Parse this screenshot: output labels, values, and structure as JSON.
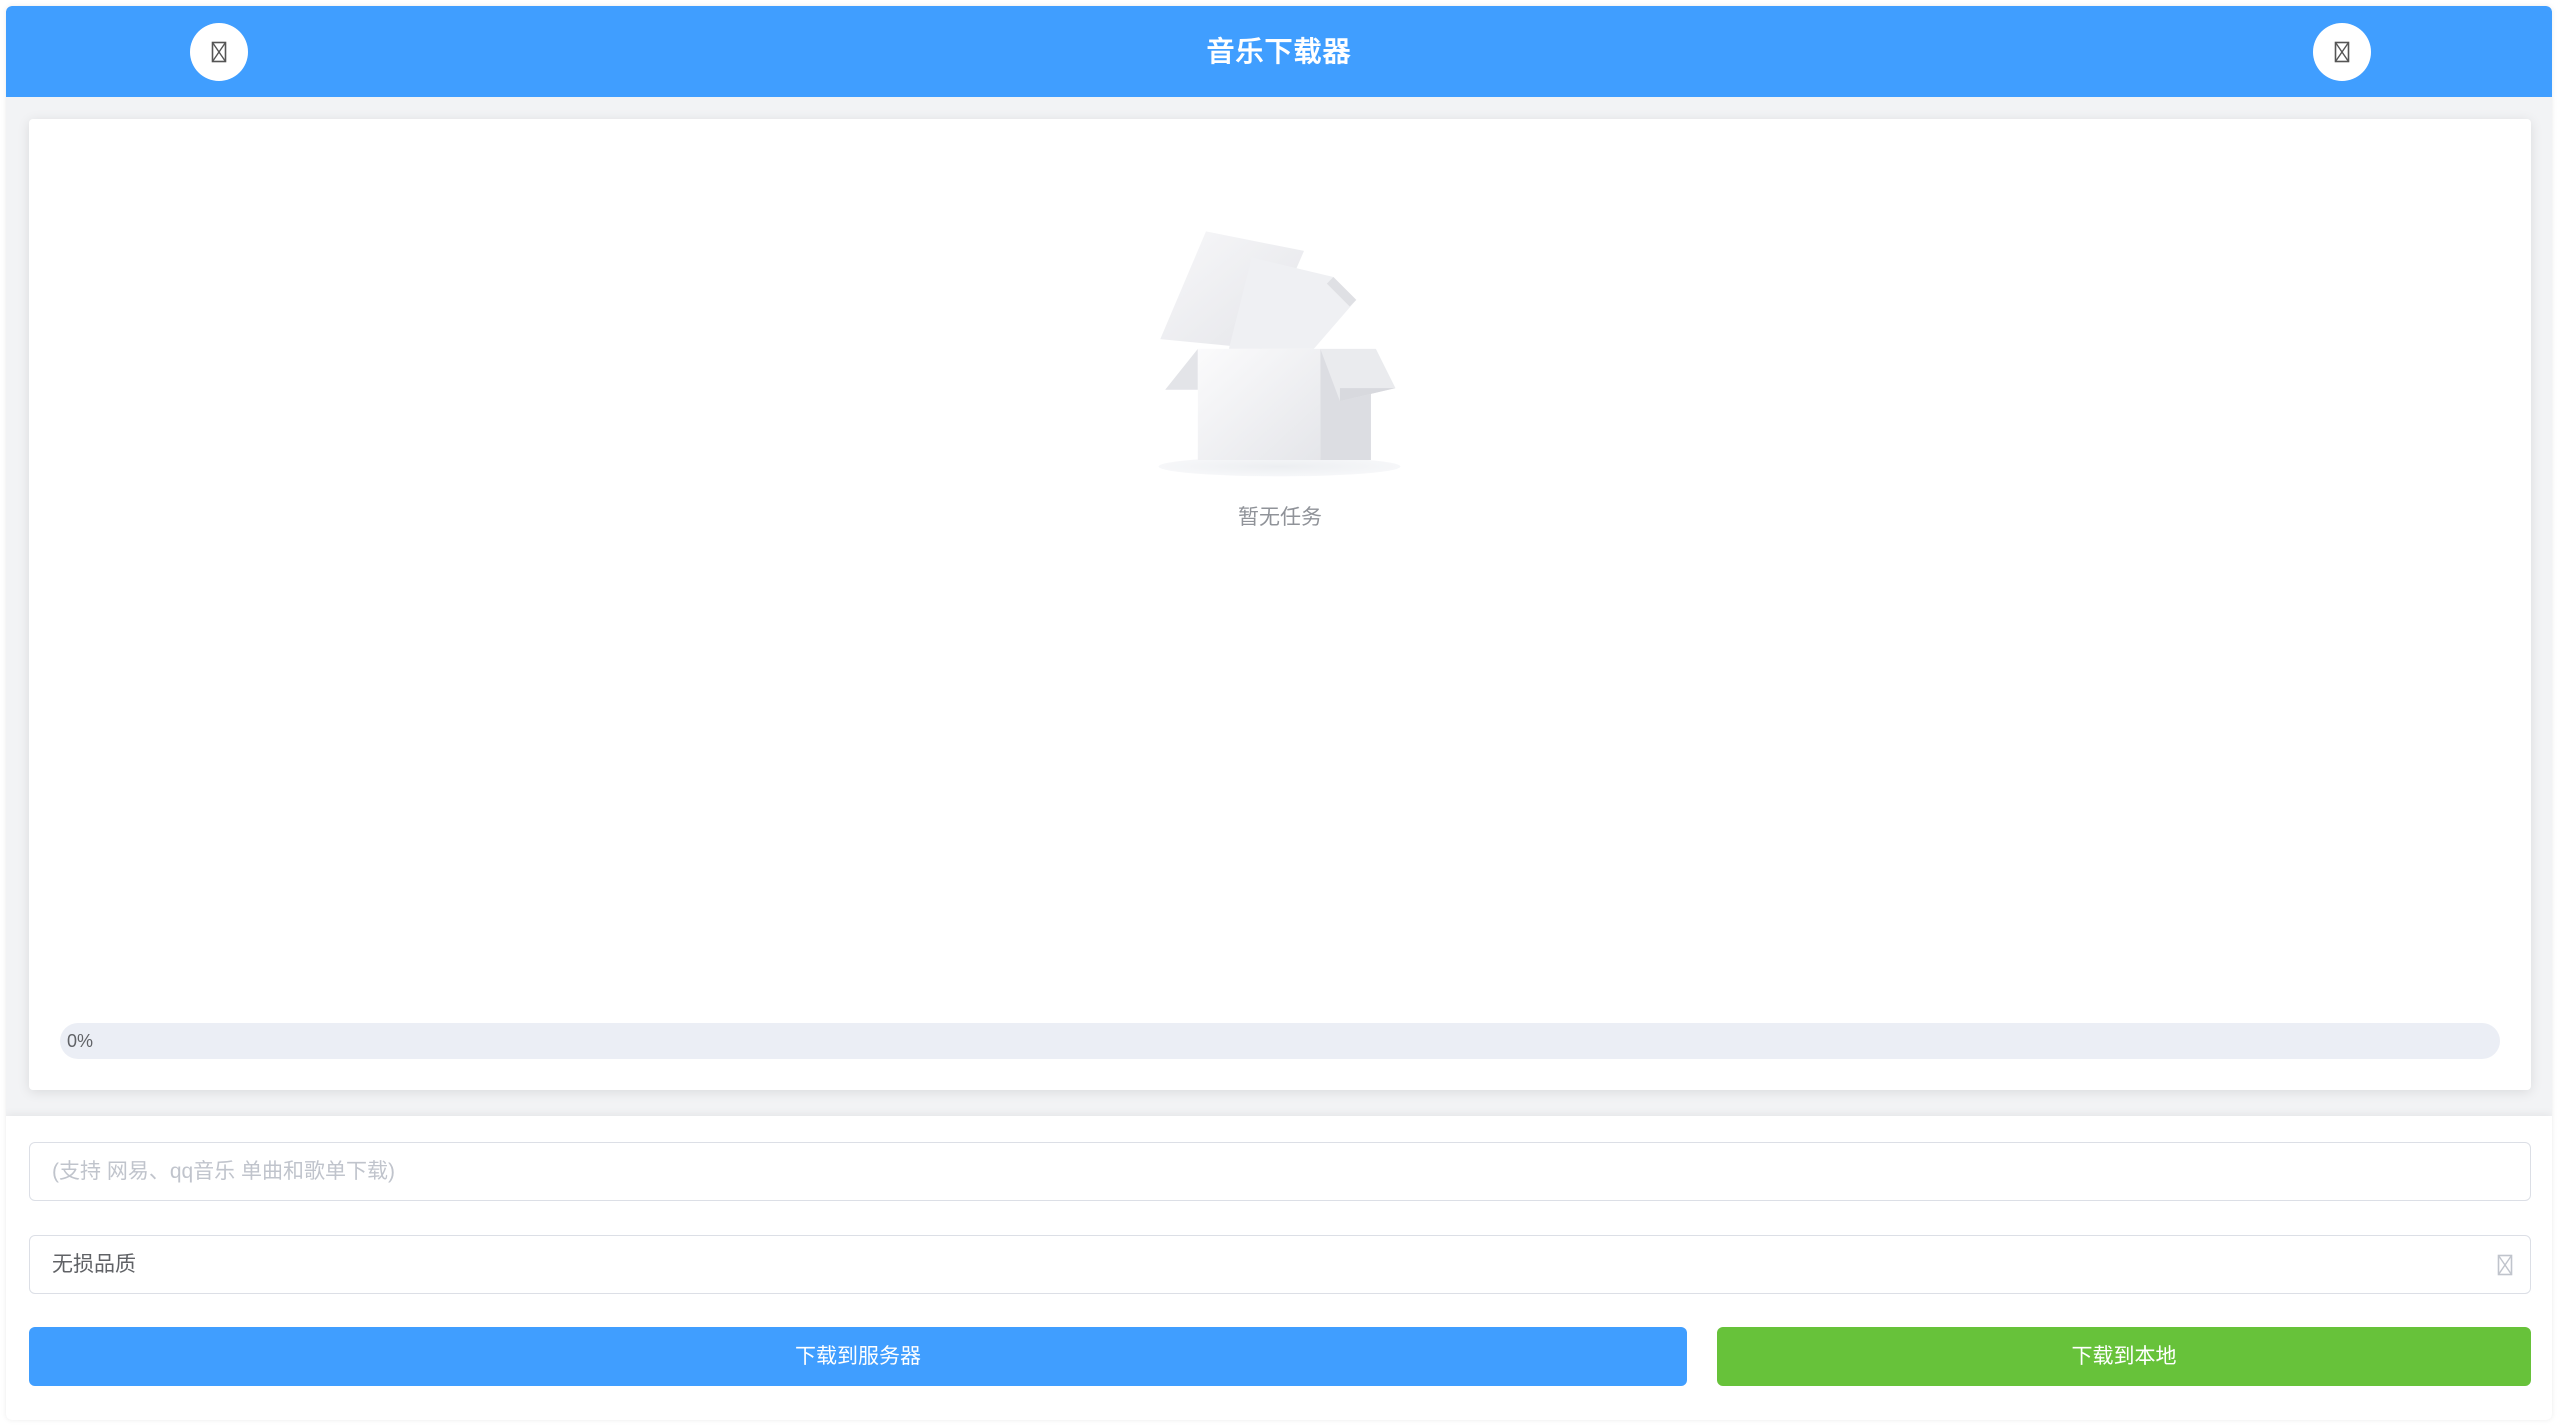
{
  "header": {
    "title": "音乐下载器",
    "left_button_icon": "missing-glyph-icon",
    "right_button_icon": "missing-glyph-icon",
    "background_color": "#409eff"
  },
  "task_panel": {
    "empty_image": "empty-box-illustration",
    "empty_text": "暂无任务",
    "progress": {
      "label": "0%",
      "value": 0
    }
  },
  "form": {
    "link_input": {
      "placeholder": "(支持 网易、qq音乐 单曲和歌单下载)",
      "value": ""
    },
    "quality_select": {
      "selected": "无损品质",
      "icon": "missing-glyph-icon"
    },
    "download_server_label": "下载到服务器",
    "download_local_label": "下载到本地",
    "server_button_color": "#409eff",
    "local_button_color": "#67c23a"
  }
}
